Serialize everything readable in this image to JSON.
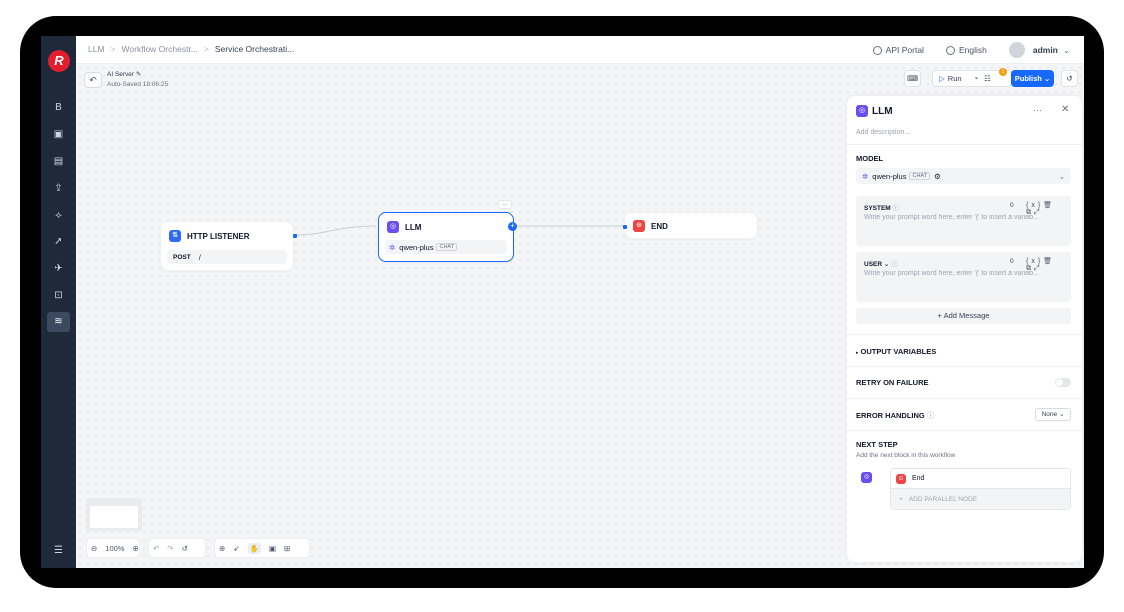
{
  "breadcrumbs": [
    "LLM",
    "Workflow Orchestr...",
    "Service Orchestrati..."
  ],
  "topbar": {
    "api_portal": "API Portal",
    "language": "English",
    "user": "admin"
  },
  "sidebar": {
    "logo": "R",
    "items": [
      "B",
      "▣",
      "▤",
      "⇪",
      "⟡",
      "➚",
      "✈",
      "⊡",
      "≋"
    ],
    "footer": "☰"
  },
  "canvas": {
    "server_name": "AI Server",
    "autosave": "Auto-Saved 18:06:25",
    "run_label": "Run",
    "publish_label": "Publish",
    "badge": "1",
    "zoom": "100%"
  },
  "nodes": {
    "http": {
      "title": "HTTP LISTENER",
      "method": "POST",
      "path": "/"
    },
    "llm": {
      "title": "LLM",
      "model": "qwen-plus",
      "tag": "CHAT"
    },
    "end": {
      "title": "END"
    }
  },
  "panel": {
    "title": "LLM",
    "description_placeholder": "Add description...",
    "model_label": "MODEL",
    "model": "qwen-plus",
    "model_tag": "CHAT",
    "system_label": "SYSTEM",
    "system_count": "0",
    "system_placeholder": "Write your prompt word here, enter '{' to insert a variab...",
    "user_label": "USER",
    "user_count": "0",
    "user_placeholder": "Write your prompt word here, enter '{' to insert a variab...",
    "add_message": "+ Add Message",
    "output_variables": "OUTPUT VARIABLES",
    "retry": "RETRY ON FAILURE",
    "error_handling": "ERROR HANDLING",
    "error_value": "None",
    "next_step": "NEXT STEP",
    "next_hint": "Add the next block in this workflow",
    "next_end": "End",
    "add_parallel": "ADD PARALLEL NODE"
  },
  "colors": {
    "accent": "#1668ff",
    "sidebar": "#1e2a3a",
    "llm": "#6b4ef0",
    "end": "#ef4444"
  }
}
